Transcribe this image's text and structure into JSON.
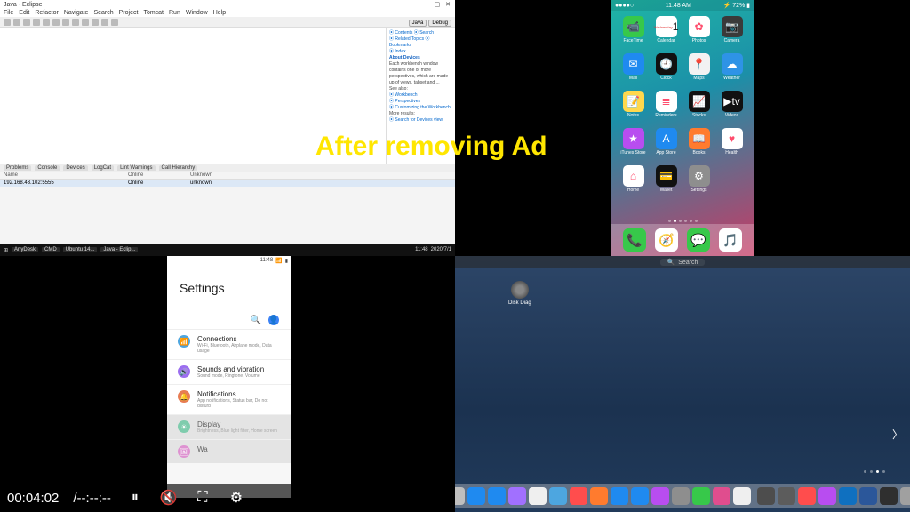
{
  "eclipse": {
    "title": "Java - Eclipse",
    "menus": [
      "File",
      "Edit",
      "Refactor",
      "Navigate",
      "Search",
      "Project",
      "Tomcat",
      "Run",
      "Window",
      "Help"
    ],
    "perspectives": {
      "java": "Java",
      "debug": "Debug"
    },
    "help": {
      "links1": [
        "Contents",
        "Search"
      ],
      "links2": [
        "Related Topics",
        "Bookmarks",
        "Index"
      ],
      "section": "About Devices",
      "body": "Each workbench window contains one or more perspectives, which are made up of views, tabset and ...",
      "seealso": "See also:",
      "sa1": "Workbench",
      "sa2": "Perspectives",
      "sa3": "Customizing the Workbench",
      "more": "More results:",
      "mr1": "Search for Devices view"
    },
    "bottom_tabs": [
      "Problems",
      "Console",
      "Devices",
      "LogCat",
      "Lint Warnings",
      "Call Hierarchy"
    ],
    "cols": [
      "Name",
      "",
      "Online",
      "Unknown"
    ],
    "row": [
      "192.168.43.102:5555",
      "",
      "Online",
      "unknown"
    ]
  },
  "taskbar": {
    "items": [
      "AnyDesk",
      "",
      "CMD",
      "Ubuntu 14...",
      "",
      "",
      "",
      "",
      "",
      "",
      "Java - Eclip..."
    ],
    "time": "11:48",
    "date": "2020/7/1"
  },
  "iphone": {
    "time": "11:48 AM",
    "day": "Wednesday",
    "daynum": "1",
    "battery": "72%",
    "apps": [
      {
        "l": "FaceTime",
        "c": "#37c84a",
        "g": "📹"
      },
      {
        "l": "Calendar",
        "c": "#ffffff",
        "g": "",
        "cal": true
      },
      {
        "l": "Photos",
        "c": "#ffffff",
        "g": "✿"
      },
      {
        "l": "Camera",
        "c": "#3a3a3a",
        "g": "📷"
      },
      {
        "l": "Mail",
        "c": "#1f8af0",
        "g": "✉"
      },
      {
        "l": "Clock",
        "c": "#111111",
        "g": "🕘"
      },
      {
        "l": "Maps",
        "c": "#f2f2f2",
        "g": "📍"
      },
      {
        "l": "Weather",
        "c": "#2e93e6",
        "g": "☁"
      },
      {
        "l": "Notes",
        "c": "#ffd84d",
        "g": "📝"
      },
      {
        "l": "Reminders",
        "c": "#ffffff",
        "g": "≣"
      },
      {
        "l": "Stocks",
        "c": "#111111",
        "g": "📈"
      },
      {
        "l": "Videos",
        "c": "#111111",
        "g": "▶tv"
      },
      {
        "l": "iTunes Store",
        "c": "#b84df0",
        "g": "★"
      },
      {
        "l": "App Store",
        "c": "#1f8af0",
        "g": "A"
      },
      {
        "l": "Books",
        "c": "#ff7b2e",
        "g": "📖"
      },
      {
        "l": "Health",
        "c": "#ffffff",
        "g": "♥"
      },
      {
        "l": "Home",
        "c": "#ffffff",
        "g": "⌂"
      },
      {
        "l": "Wallet",
        "c": "#111111",
        "g": "💳"
      },
      {
        "l": "Settings",
        "c": "#8e8e8e",
        "g": "⚙"
      }
    ],
    "dock": [
      {
        "n": "phone",
        "c": "#37c84a",
        "g": "📞"
      },
      {
        "n": "safari",
        "c": "#ffffff",
        "g": "🧭"
      },
      {
        "n": "messages",
        "c": "#37c84a",
        "g": "💬"
      },
      {
        "n": "music",
        "c": "#ffffff",
        "g": "🎵"
      }
    ]
  },
  "android": {
    "time": "11:48",
    "title": "Settings",
    "items": [
      {
        "t": "Connections",
        "s": "Wi-Fi, Bluetooth, Airplane mode, Data usage",
        "c": "#4da6e0",
        "g": "📶"
      },
      {
        "t": "Sounds and vibration",
        "s": "Sound mode, Ringtone, Volume",
        "c": "#9c6ef0",
        "g": "🔊"
      },
      {
        "t": "Notifications",
        "s": "App notifications, Status bar, Do not disturb",
        "c": "#e87c52",
        "g": "🔔"
      },
      {
        "t": "Display",
        "s": "Brightness, Blue light filter, Home screen",
        "c": "#4dbb8f",
        "g": "☀",
        "dim": true
      },
      {
        "t": "Wa",
        "s": "",
        "c": "#d468c2",
        "g": "🖼",
        "dim": true
      }
    ]
  },
  "overlay_text": "After removing Ad",
  "mac": {
    "spotlight": "Search",
    "desk_label": "Disk Diag",
    "dock": [
      "#bfbfbf",
      "#1f8af0",
      "#1f8af0",
      "#a170ff",
      "#efefef",
      "#4da6e0",
      "#ff4d4d",
      "#ff7b2e",
      "#1f8af0",
      "#1f8af0",
      "#b84df0",
      "#8e8e8e",
      "#37c84a",
      "#e04d8e",
      "#efefef",
      "#4d4d4d",
      "#5c5c5c",
      "#ff4d4d",
      "#b84df0",
      "#0f70c0",
      "#2b579a",
      "#2f2f2f",
      "#a0a0a0"
    ]
  },
  "video": {
    "time": "00:04:02",
    "dur": "/--:--:--"
  }
}
